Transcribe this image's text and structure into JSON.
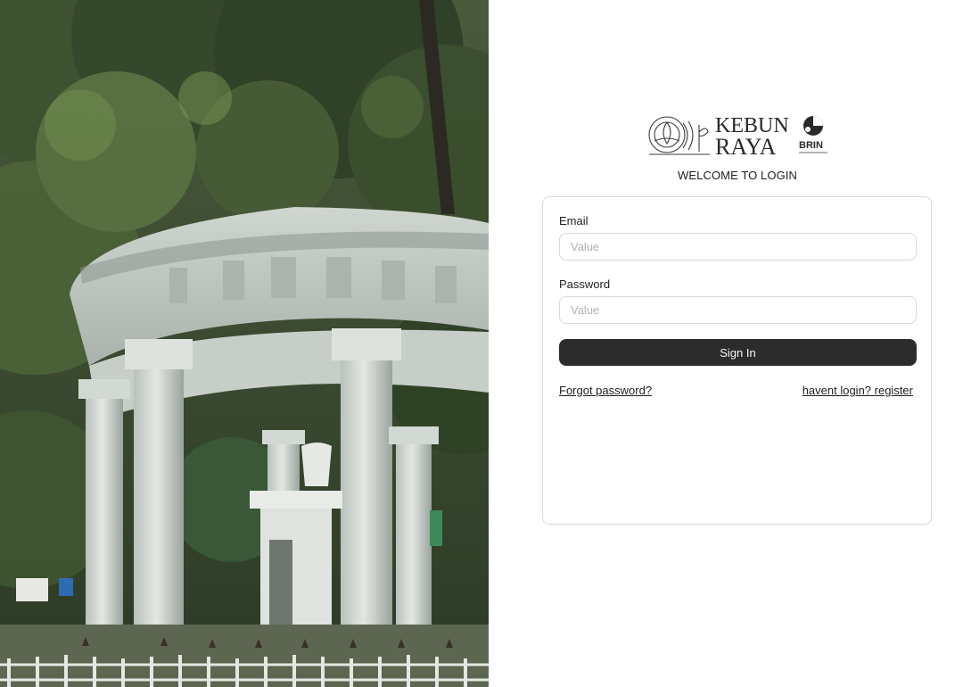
{
  "brand": {
    "logo_line1": "KEBUN",
    "logo_line2": "RAYA",
    "partner_logo": "BRIN"
  },
  "login": {
    "welcome_text": "WELCOME TO LOGIN",
    "email_label": "Email",
    "email_placeholder": "Value",
    "email_value": "",
    "password_label": "Password",
    "password_placeholder": "Value",
    "password_value": "",
    "sign_in_label": "Sign In",
    "forgot_password_label": "Forgot password?",
    "register_label": "havent login? register"
  },
  "colors": {
    "button_bg": "#2c2c2c",
    "button_text": "#f5f5f5",
    "border": "#d9d9d9",
    "placeholder": "#b3b3b3",
    "text": "#1e1e1e"
  },
  "icons": [
    "garden-emblem-icon",
    "brin-emblem-icon"
  ]
}
